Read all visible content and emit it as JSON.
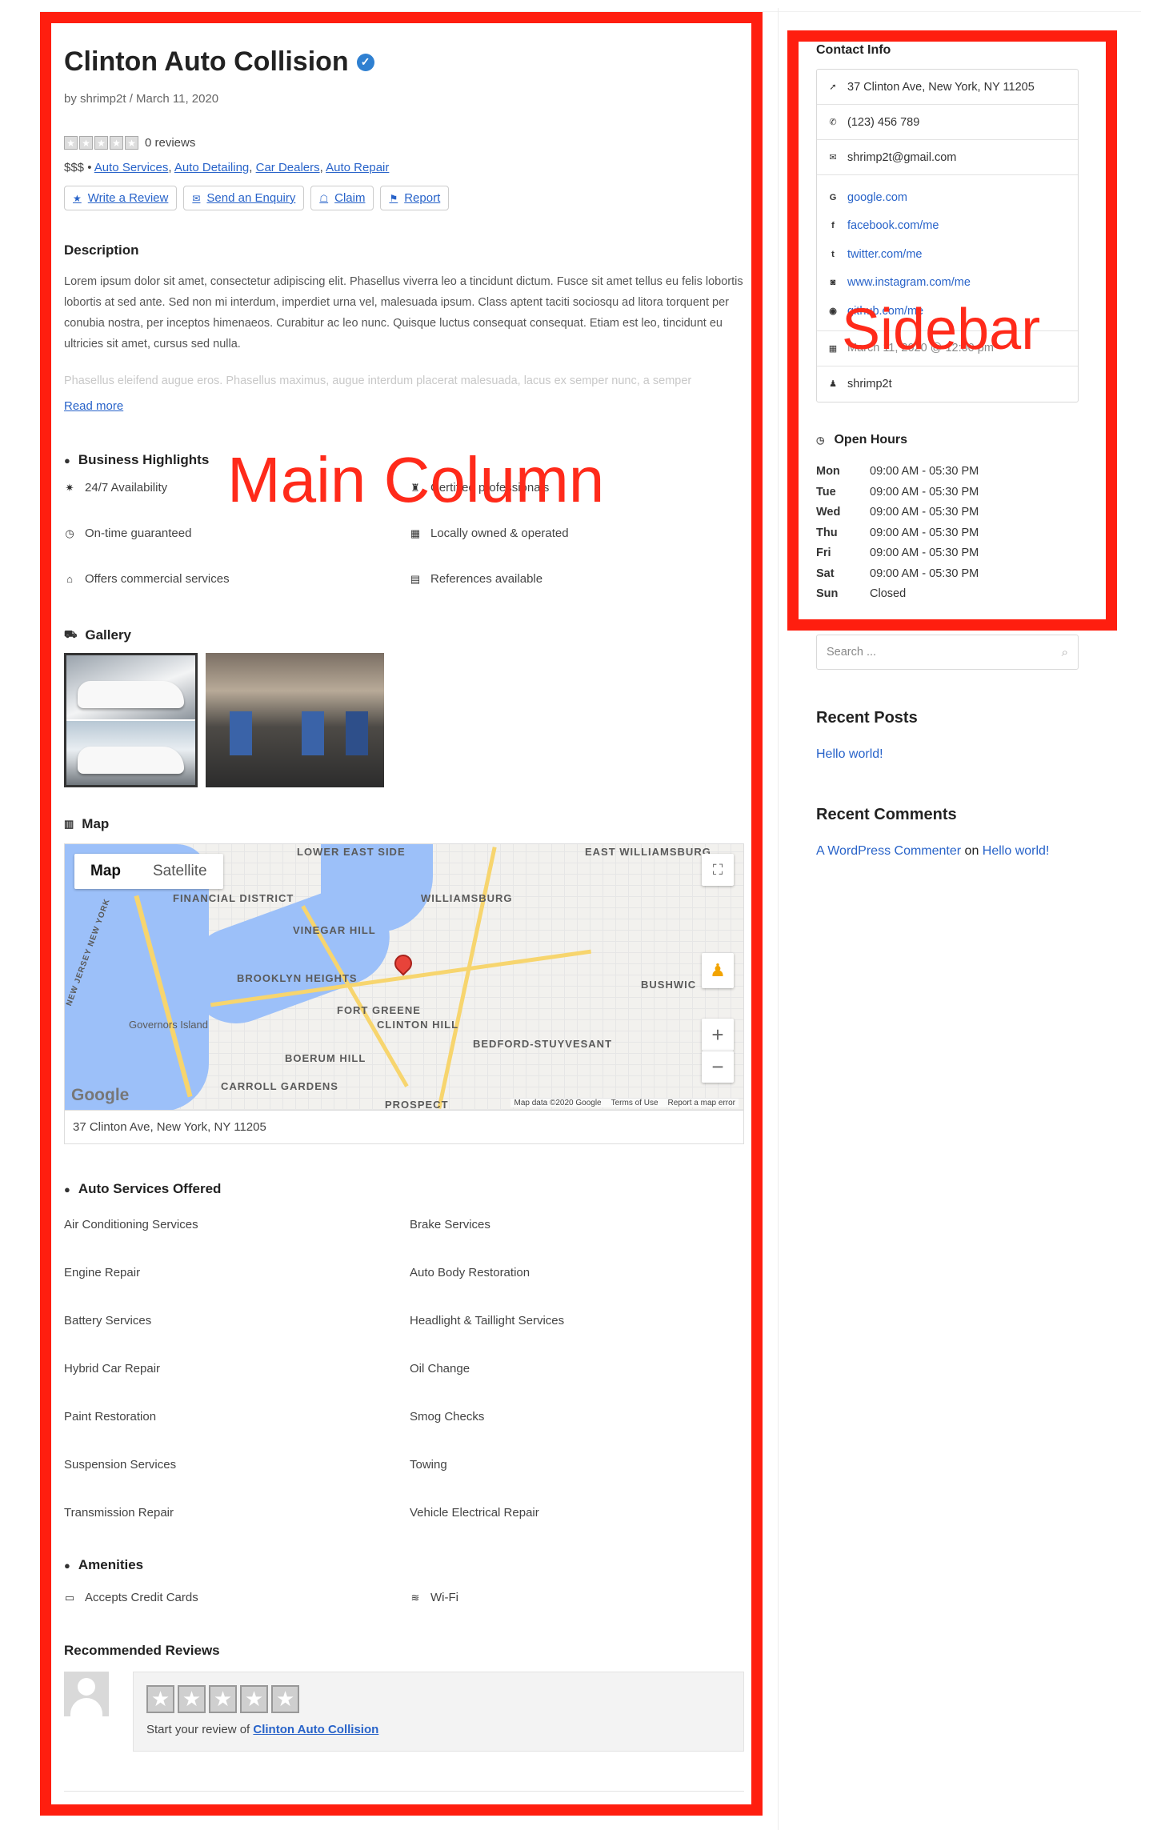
{
  "annotations": {
    "main_label": "Main Column",
    "side_label": "Sidebar"
  },
  "listing": {
    "title": "Clinton Auto Collision",
    "author": "shrimp2t",
    "date": "March 11, 2020",
    "byline": "by shrimp2t / March 11, 2020",
    "reviews_count": "0 reviews",
    "price": "$$$",
    "categories": [
      "Auto Services",
      "Auto Detailing",
      "Car Dealers",
      "Auto Repair"
    ],
    "actions": [
      {
        "label": "Write a Review",
        "icon": "star-icon"
      },
      {
        "label": "Send an Enquiry",
        "icon": "envelope-icon"
      },
      {
        "label": "Claim",
        "icon": "claim-icon"
      },
      {
        "label": "Report",
        "icon": "flag-icon"
      }
    ]
  },
  "description": {
    "heading": "Description",
    "text": "Lorem ipsum dolor sit amet, consectetur adipiscing elit. Phasellus viverra leo a tincidunt dictum. Fusce sit amet tellus eu felis lobortis lobortis at sed ante. Sed non mi interdum, imperdiet urna vel, malesuada ipsum. Class aptent taciti sociosqu ad litora torquent per conubia nostra, per inceptos himenaeos. Curabitur ac leo nunc. Quisque luctus consequat consequat. Etiam est leo, tincidunt eu ultricies sit amet, cursus sed nulla.",
    "faded": "Phasellus eleifend augue eros. Phasellus maximus, augue interdum placerat malesuada, lacus ex semper nunc, a semper",
    "read_more": "Read more"
  },
  "highlights": {
    "heading": "Business Highlights",
    "items": [
      {
        "label": "24/7 Availability",
        "icon": "sun-icon"
      },
      {
        "label": "Certified professionals",
        "icon": "award-icon"
      },
      {
        "label": "On-time guaranteed",
        "icon": "clock-icon"
      },
      {
        "label": "Locally owned & operated",
        "icon": "store-icon"
      },
      {
        "label": "Offers commercial services",
        "icon": "building-icon"
      },
      {
        "label": "References available",
        "icon": "document-icon"
      }
    ]
  },
  "gallery": {
    "heading": "Gallery"
  },
  "map": {
    "heading": "Map",
    "type_map": "Map",
    "type_satellite": "Satellite",
    "labels": [
      "LOWER EAST SIDE",
      "EAST WILLIAMSBURG",
      "FINANCIAL DISTRICT",
      "WILLIAMSBURG",
      "VINEGAR HILL",
      "BROOKLYN HEIGHTS",
      "FORT GREENE",
      "CLINTON HILL",
      "BEDFORD-STUYVESANT",
      "BOERUM HILL",
      "CARROLL GARDENS",
      "PROSPECT",
      "BUSHWIC",
      "Governors Island",
      "NEW JERSEY NEW YORK"
    ],
    "google": "Google",
    "footer": [
      "Map data ©2020 Google",
      "Terms of Use",
      "Report a map error"
    ],
    "address": "37 Clinton Ave, New York, NY 11205"
  },
  "services": {
    "heading": "Auto Services Offered",
    "items": [
      "Air Conditioning Services",
      "Brake Services",
      "Engine Repair",
      "Auto Body Restoration",
      "Battery Services",
      "Headlight & Taillight Services",
      "Hybrid Car Repair",
      "Oil Change",
      "Paint Restoration",
      "Smog Checks",
      "Suspension Services",
      "Towing",
      "Transmission Repair",
      "Vehicle Electrical Repair"
    ]
  },
  "amenities": {
    "heading": "Amenities",
    "items": [
      {
        "label": "Accepts Credit Cards",
        "icon": "credit-card-icon"
      },
      {
        "label": "Wi-Fi",
        "icon": "wifi-icon"
      }
    ]
  },
  "reviews": {
    "heading": "Recommended Reviews",
    "prompt": "Start your review of",
    "link": "Clinton Auto Collision"
  },
  "contact": {
    "heading": "Contact Info",
    "address": "37 Clinton Ave, New York, NY 11205",
    "phone": "(123) 456 789",
    "email": "shrimp2t@gmail.com",
    "links": [
      {
        "label": "google.com",
        "icon": "google-icon"
      },
      {
        "label": "facebook.com/me",
        "icon": "facebook-icon"
      },
      {
        "label": "twitter.com/me",
        "icon": "twitter-icon"
      },
      {
        "label": "www.instagram.com/me",
        "icon": "instagram-icon"
      },
      {
        "label": "github.com/me",
        "icon": "github-icon"
      }
    ],
    "date": "March 11, 2020 @ 12:00 pm",
    "owner": "shrimp2t"
  },
  "hours": {
    "heading": "Open Hours",
    "days": [
      {
        "day": "Mon",
        "time": "09:00 AM - 05:30 PM"
      },
      {
        "day": "Tue",
        "time": "09:00 AM - 05:30 PM"
      },
      {
        "day": "Wed",
        "time": "09:00 AM - 05:30 PM"
      },
      {
        "day": "Thu",
        "time": "09:00 AM - 05:30 PM"
      },
      {
        "day": "Fri",
        "time": "09:00 AM - 05:30 PM"
      },
      {
        "day": "Sat",
        "time": "09:00 AM - 05:30 PM"
      },
      {
        "day": "Sun",
        "time": "Closed"
      }
    ]
  },
  "widgets": {
    "search_placeholder": "Search ...",
    "recent_posts_title": "Recent Posts",
    "recent_post": "Hello world!",
    "recent_comments_title": "Recent Comments",
    "commenter": "A WordPress Commenter",
    "on": "on",
    "comment_post": "Hello world!"
  },
  "colors": {
    "annotation": "#ff1e0f",
    "link": "#2863c9"
  }
}
